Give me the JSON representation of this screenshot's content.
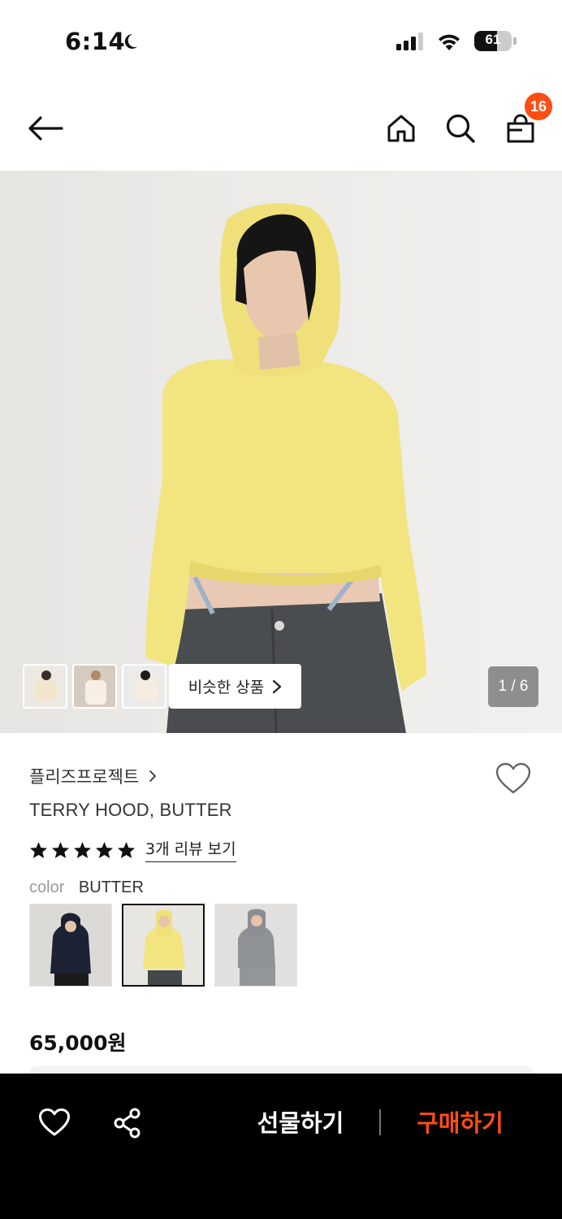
{
  "status_bar": {
    "time": "6:14",
    "battery_level": "61",
    "icons": [
      "moon-icon",
      "signal-icon",
      "wifi-icon",
      "battery-icon"
    ]
  },
  "nav": {
    "icons": [
      "back-arrow-icon",
      "home-icon",
      "search-icon",
      "shopping-bag-icon"
    ],
    "cart_count": "16"
  },
  "gallery": {
    "similar_label": "비슷한 상품",
    "page_indicator": "1 / 6"
  },
  "product": {
    "brand": "플리즈프로젝트",
    "name": "TERRY HOOD, BUTTER",
    "rating_stars": 5,
    "review_link": "3개 리뷰 보기",
    "color_label": "color",
    "color_value": "BUTTER",
    "price": "65,000원"
  },
  "bottom_bar": {
    "gift_label": "선물하기",
    "buy_label": "구매하기",
    "icons": [
      "heart-icon",
      "share-icon"
    ]
  },
  "colors": {
    "accent": "#ff4d14",
    "bottom_bar_bg": "#000000",
    "butter_yellow": "#f3e582"
  }
}
